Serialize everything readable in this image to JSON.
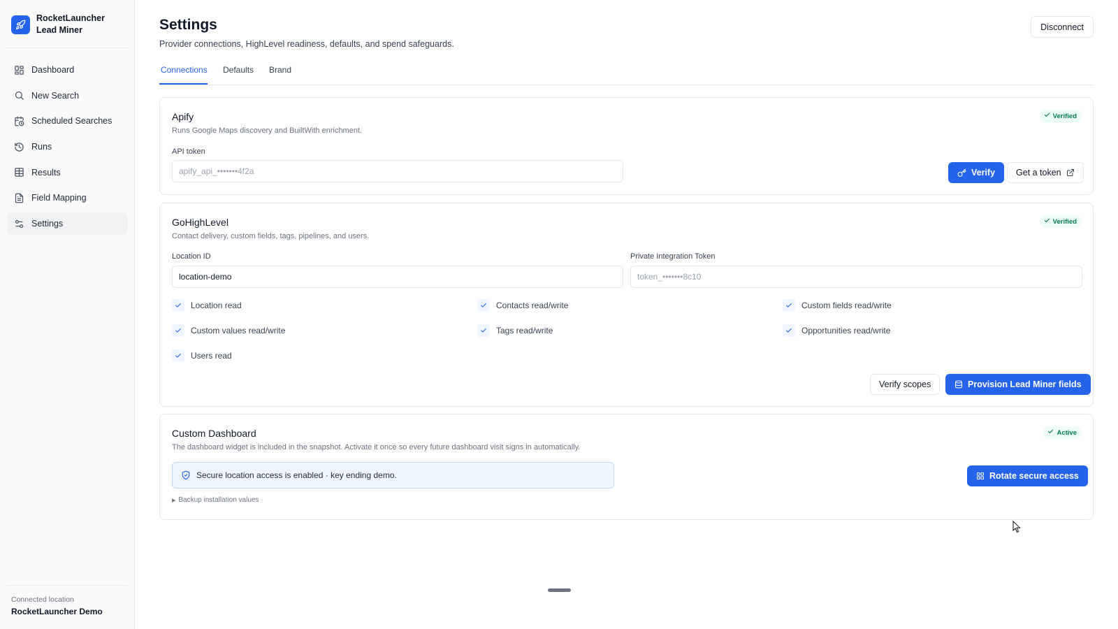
{
  "app": {
    "name_line1": "RocketLauncher",
    "name_line2": "Lead Miner"
  },
  "sidebar": {
    "items": [
      {
        "label": "Dashboard",
        "icon": "dashboard-icon"
      },
      {
        "label": "New Search",
        "icon": "search-icon"
      },
      {
        "label": "Scheduled Searches",
        "icon": "calendar-clock-icon"
      },
      {
        "label": "Runs",
        "icon": "history-icon"
      },
      {
        "label": "Results",
        "icon": "table-icon"
      },
      {
        "label": "Field Mapping",
        "icon": "file-text-icon"
      },
      {
        "label": "Settings",
        "icon": "sliders-icon",
        "active": true
      }
    ],
    "footer_label": "Connected location",
    "footer_value": "RocketLauncher Demo"
  },
  "header": {
    "title": "Settings",
    "subtitle": "Provider connections, HighLevel readiness, defaults, and spend safeguards.",
    "disconnect_label": "Disconnect"
  },
  "tabs": [
    {
      "label": "Connections",
      "active": true
    },
    {
      "label": "Defaults"
    },
    {
      "label": "Brand"
    }
  ],
  "apify": {
    "title": "Apify",
    "description": "Runs Google Maps discovery and BuiltWith enrichment.",
    "badge": "Verified",
    "token_label": "API token",
    "token_placeholder": "apify_api_•••••••4f2a",
    "verify_label": "Verify",
    "get_token_label": "Get a token"
  },
  "ghl": {
    "title": "GoHighLevel",
    "description": "Contact delivery, custom fields, tags, pipelines, and users.",
    "badge": "Verified",
    "location_label": "Location ID",
    "location_value": "location-demo",
    "pit_label": "Private Integration Token",
    "pit_placeholder": "token_•••••••8c10",
    "scopes": [
      "Location read",
      "Contacts read/write",
      "Custom fields read/write",
      "Custom values read/write",
      "Tags read/write",
      "Opportunities read/write",
      "Users read"
    ],
    "verify_scopes_label": "Verify scopes",
    "provision_label": "Provision Lead Miner fields"
  },
  "dashboard": {
    "title": "Custom Dashboard",
    "description": "The dashboard widget is included in the snapshot. Activate it once so every future dashboard visit signs in automatically.",
    "badge": "Active",
    "info_text": "Secure location access is enabled · key ending demo.",
    "rotate_label": "Rotate secure access",
    "backup_label": "Backup installation values"
  },
  "colors": {
    "accent": "#2563eb",
    "success": "#047857",
    "border": "#e5e7eb"
  }
}
